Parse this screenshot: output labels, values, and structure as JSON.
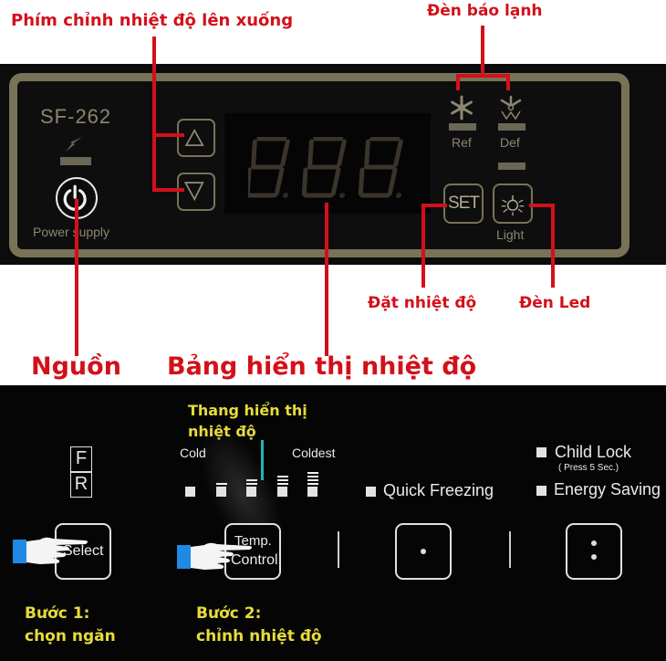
{
  "annotations": {
    "adjust_keys": "Phím chỉnh nhiệt độ lên xuống",
    "cold_indicator": "Đèn báo lạnh",
    "set_temp": "Đặt nhiệt độ",
    "led_light": "Đèn Led",
    "power": "Nguồn",
    "display": "Bảng hiển thị nhiệt độ"
  },
  "top_panel": {
    "model": "SF-262",
    "power_label": "Power supply",
    "display_digits": "8.8.8.",
    "ref_label": "Ref",
    "def_label": "Def",
    "set_button": "SET",
    "light_label": "Light",
    "icons": [
      "lightning-icon",
      "power-icon",
      "up-arrow-icon",
      "down-arrow-icon",
      "snowflake-icon",
      "defrost-icon",
      "bulb-icon"
    ]
  },
  "bottom_panel": {
    "compartments": [
      "F",
      "R"
    ],
    "scale_title_line1": "Thang hiển thị",
    "scale_title_line2": "nhiệt độ",
    "scale_cold": "Cold",
    "scale_coldest": "Coldest",
    "scale_levels": 5,
    "quick_freezing": "Quick Freezing",
    "child_lock": "Child Lock",
    "child_lock_hint": "( Press 5 Sec.)",
    "energy_saving": "Energy Saving",
    "select_button": "Select",
    "temp_button_line1": "Temp.",
    "temp_button_line2": "Control",
    "step1_title": "Bước 1:",
    "step1_desc": "chọn ngăn",
    "step2_title": "Bước 2:",
    "step2_desc": "chỉnh nhiệt độ"
  },
  "colors": {
    "annotation_red": "#d3101a",
    "frame_tan": "#7a7257",
    "instruction_yellow": "#e6dc3a",
    "indicator_cyan": "#1fb5b5",
    "hand_cuff_blue": "#1e8ae6"
  }
}
